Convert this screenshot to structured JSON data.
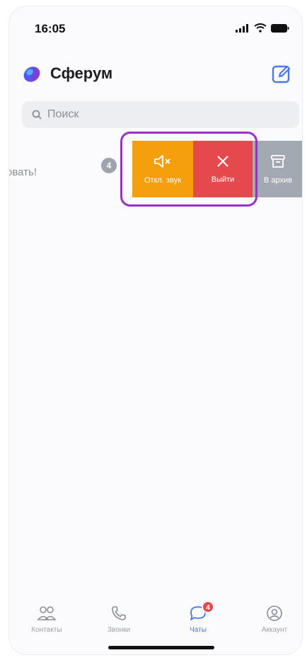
{
  "status_bar": {
    "time": "16:05"
  },
  "header": {
    "title": "Сферум"
  },
  "search": {
    "placeholder": "Поиск"
  },
  "chat_row": {
    "preview_text": "овать!",
    "unread_count": "4",
    "actions": {
      "mute_label": "Откл. звук",
      "leave_label": "Выйти",
      "archive_label": "В архив"
    }
  },
  "tab_bar": {
    "tabs": [
      {
        "label": "Контакты",
        "icon": "contacts-icon"
      },
      {
        "label": "Звонки",
        "icon": "phone-icon"
      },
      {
        "label": "Чаты",
        "icon": "chat-icon",
        "badge": "4",
        "active": true
      },
      {
        "label": "Аккаунт",
        "icon": "account-icon"
      }
    ]
  },
  "colors": {
    "mute": "#f59f0c",
    "leave": "#e5484d",
    "archive": "#a3a9b3",
    "highlight": "#9b2fc9",
    "accent": "#4a78e8"
  }
}
